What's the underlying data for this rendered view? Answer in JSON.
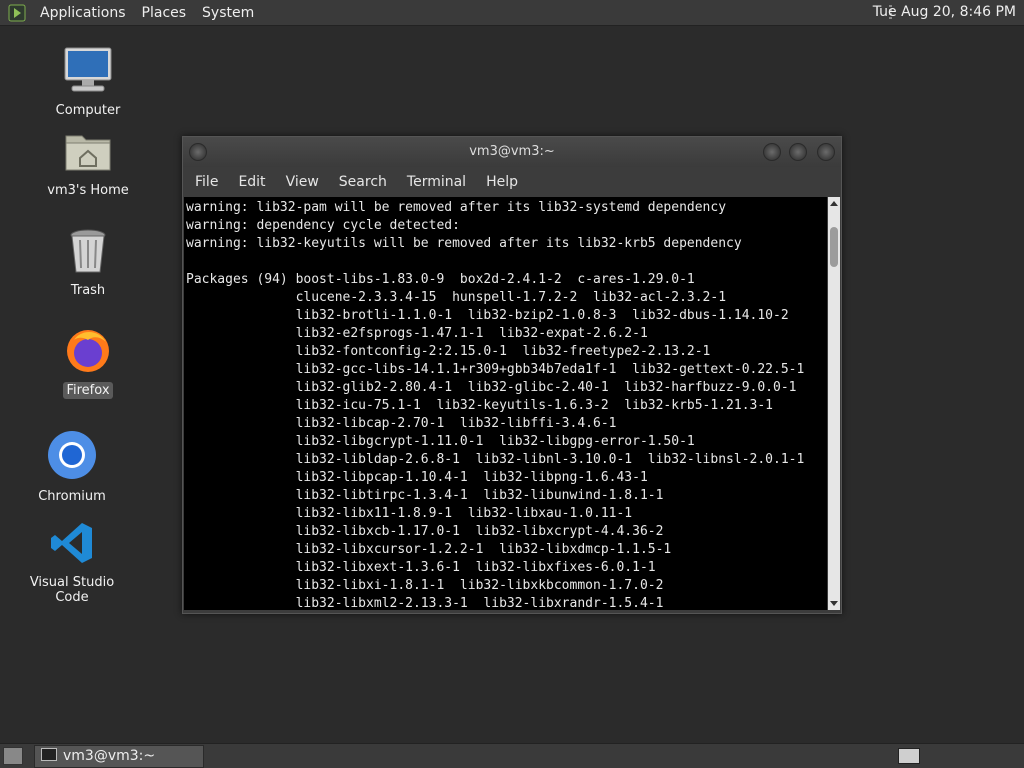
{
  "top_panel": {
    "menus": [
      "Applications",
      "Places",
      "System"
    ],
    "clock": "Tue Aug 20,  8:46 PM"
  },
  "desktop": {
    "icons": [
      {
        "label": "Computer",
        "icon": "computer-icon"
      },
      {
        "label": "vm3's Home",
        "icon": "home-folder-icon"
      },
      {
        "label": "Trash",
        "icon": "trash-icon"
      },
      {
        "label": "Firefox",
        "icon": "firefox-icon"
      },
      {
        "label": "Chromium",
        "icon": "chromium-icon"
      },
      {
        "label": "Visual Studio Code",
        "icon": "vscode-icon"
      }
    ]
  },
  "terminal": {
    "title": "vm3@vm3:~",
    "menu": [
      "File",
      "Edit",
      "View",
      "Search",
      "Terminal",
      "Help"
    ],
    "lines": [
      "warning: lib32-pam will be removed after its lib32-systemd dependency",
      "warning: dependency cycle detected:",
      "warning: lib32-keyutils will be removed after its lib32-krb5 dependency",
      "",
      "Packages (94) boost-libs-1.83.0-9  box2d-2.4.1-2  c-ares-1.29.0-1",
      "              clucene-2.3.3.4-15  hunspell-1.7.2-2  lib32-acl-2.3.2-1",
      "              lib32-brotli-1.1.0-1  lib32-bzip2-1.0.8-3  lib32-dbus-1.14.10-2",
      "              lib32-e2fsprogs-1.47.1-1  lib32-expat-2.6.2-1",
      "              lib32-fontconfig-2:2.15.0-1  lib32-freetype2-2.13.2-1",
      "              lib32-gcc-libs-14.1.1+r309+gbb34b7eda1f-1  lib32-gettext-0.22.5-1",
      "              lib32-glib2-2.80.4-1  lib32-glibc-2.40-1  lib32-harfbuzz-9.0.0-1",
      "              lib32-icu-75.1-1  lib32-keyutils-1.6.3-2  lib32-krb5-1.21.3-1",
      "              lib32-libcap-2.70-1  lib32-libffi-3.4.6-1",
      "              lib32-libgcrypt-1.11.0-1  lib32-libgpg-error-1.50-1",
      "              lib32-libldap-2.6.8-1  lib32-libnl-3.10.0-1  lib32-libnsl-2.0.1-1",
      "              lib32-libpcap-1.10.4-1  lib32-libpng-1.6.43-1",
      "              lib32-libtirpc-1.3.4-1  lib32-libunwind-1.8.1-1",
      "              lib32-libx11-1.8.9-1  lib32-libxau-1.0.11-1",
      "              lib32-libxcb-1.17.0-1  lib32-libxcrypt-4.4.36-2",
      "              lib32-libxcursor-1.2.2-1  lib32-libxdmcp-1.1.5-1",
      "              lib32-libxext-1.3.6-1  lib32-libxfixes-6.0.1-1",
      "              lib32-libxi-1.8.1-1  lib32-libxkbcommon-1.7.0-2",
      "              lib32-libxml2-2.13.3-1  lib32-libxrandr-1.5.4-1"
    ]
  },
  "bottom_panel": {
    "task_label": "vm3@vm3:~"
  }
}
